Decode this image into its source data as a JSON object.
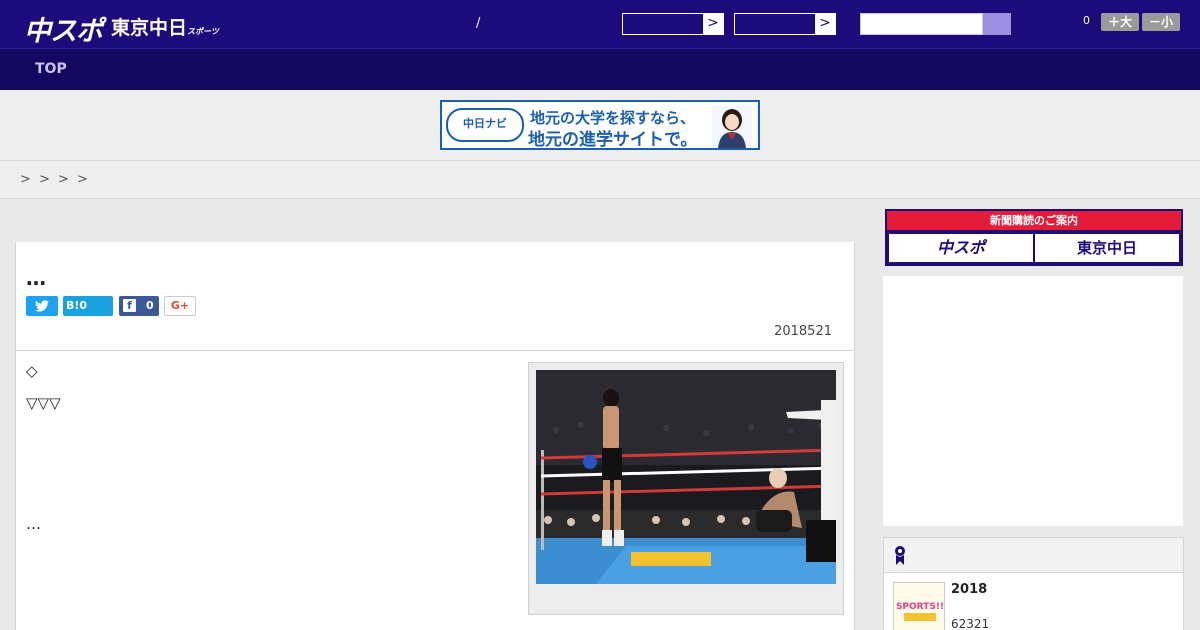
{
  "header": {
    "logo_primary": "中スポ",
    "logo_secondary": "東京中日",
    "logo_secondary_small": "スポーツ",
    "separator": "/",
    "dropdown_arrow": ">",
    "font_size_count": "0",
    "font_larger_label": "＋大",
    "font_smaller_label": "－小"
  },
  "nav": {
    "items": [
      {
        "label": "TOP"
      }
    ]
  },
  "ad_banner": {
    "logo_text": "中日ナビ",
    "line1": "地元の大学を探すなら、",
    "line2": "地元の進学サイトで。"
  },
  "breadcrumb": {
    "separators": [
      ">",
      ">",
      ">",
      ">"
    ]
  },
  "article": {
    "title": "…",
    "share": {
      "twitter_icon": "twitter-icon",
      "hatena_label": "B!0",
      "facebook_icon_text": "f",
      "facebook_count": "0",
      "google_label": "G+"
    },
    "date": "2018521",
    "body": {
      "line1": "◇",
      "line2": "▽▽▽",
      "line3": "…"
    }
  },
  "sidebar": {
    "subscribe_heading": "新聞購読のご案内",
    "subscribe_chuspo": "中スポ",
    "subscribe_tokyo": "東京中日",
    "ranking_thumb_text": "SPORTS!!",
    "ranking_title": "2018",
    "ranking_sub": "62321"
  },
  "colors": {
    "header_bg": "#1c0b7a",
    "nav_bg": "#14075f",
    "accent_red": "#d9261c",
    "accent_purple": "#7a6cc4",
    "subscribe_red": "#e41c3a"
  }
}
